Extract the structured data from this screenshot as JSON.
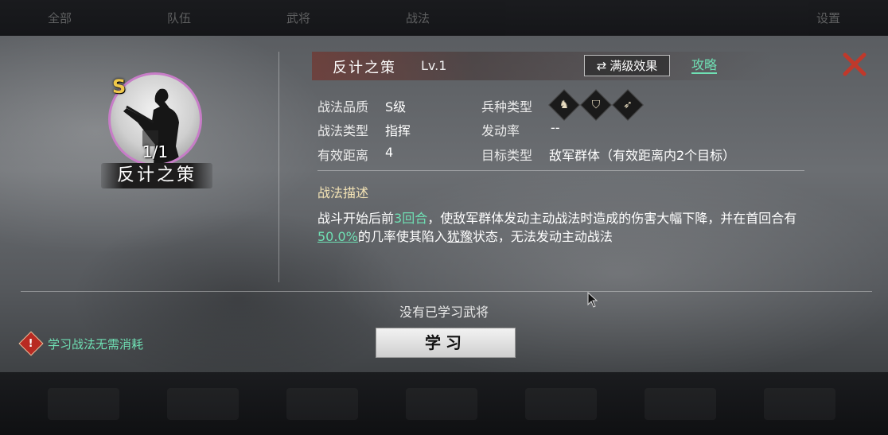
{
  "topbar": {
    "tabs": [
      "全部",
      "队伍",
      "武将",
      "战法",
      "设置"
    ]
  },
  "skill": {
    "name": "反计之策",
    "grade": "S",
    "count": "1/1",
    "level": "Lv.1"
  },
  "buttons": {
    "max_effect": "满级效果",
    "guide": "攻略",
    "learn": "学习"
  },
  "attributes": {
    "quality_label": "战法品质",
    "quality_value": "S级",
    "type_label": "战法类型",
    "type_value": "指挥",
    "range_label": "有效距离",
    "range_value": "4",
    "troop_label": "兵种类型",
    "rate_label": "发动率",
    "rate_value": "--",
    "target_label": "目标类型",
    "target_value": "敌军群体（有效距离内2个目标）"
  },
  "troop_icons": [
    "cavalry-icon",
    "shield-icon",
    "archer-icon"
  ],
  "description": {
    "title": "战法描述",
    "p1": "战斗开始后前",
    "rounds": "3回合",
    "p2": "，使敌军群体发动主动战法时造成的伤害大幅下降，并在首回合有",
    "chance": "50.0%",
    "p3": "的几率使其陷入",
    "status": "犹豫",
    "p4": "状态，无法发动主动战法"
  },
  "no_learned": "没有已学习武将",
  "warning": "学习战法无需消耗",
  "colors": {
    "accent": "#6fe0b4",
    "grade": "#f0c84a",
    "portrait_border": "#c77dc7",
    "warn": "#b82a22"
  }
}
